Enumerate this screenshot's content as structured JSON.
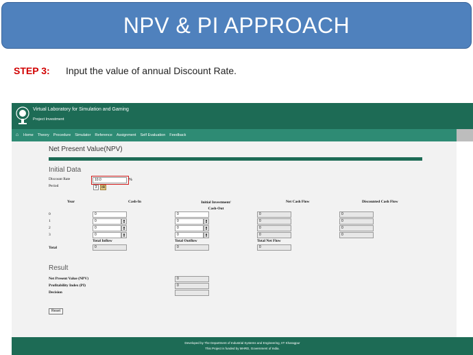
{
  "slide": {
    "title": "NPV & PI APPROACH",
    "step_label": "STEP 3:",
    "step_text": "Input the value of annual Discount Rate."
  },
  "app": {
    "title": "Virtual Laboratory for Simulation and Gaming",
    "subtitle": "Project Investment",
    "nav": [
      "Home",
      "Theory",
      "Procedure",
      "Simulator",
      "Reference",
      "Assignment",
      "Self Evaluation",
      "Feedback"
    ],
    "home_icon": "home-icon",
    "logo_icon": "iit-emblem"
  },
  "page": {
    "title": "Net Present Value(NPV)",
    "initial_heading": "Initial Data",
    "discount_label": "Discount Rate",
    "discount_value": "10.0",
    "discount_unit": "%",
    "period_label": "Period",
    "period_value": "3",
    "period_btn": "ok",
    "columns": [
      "Year",
      "Cash-In",
      "Initial Investment/ Cash-Out",
      "Net Cash Flow",
      "Discounted Cash Flow"
    ],
    "rows": [
      {
        "year": "0",
        "cash_in": "0",
        "cash_out": "0",
        "net": "0",
        "discounted": "0"
      },
      {
        "year": "1",
        "cash_in": "0",
        "cash_out": "0",
        "net": "0",
        "discounted": "0"
      },
      {
        "year": "2",
        "cash_in": "0",
        "cash_out": "0",
        "net": "0",
        "discounted": "0"
      },
      {
        "year": "3",
        "cash_in": "0",
        "cash_out": "0",
        "net": "0",
        "discounted": "0"
      }
    ],
    "total_inflow_label": "Total Inflow",
    "total_outflow_label": "Total Outflow",
    "total_net_label": "Total Net Flow",
    "total_label": "Total",
    "total_inflow": "0",
    "total_outflow": "0",
    "total_net": "0",
    "result_heading": "Result",
    "npv_label": "Net Present Value (NPV)",
    "npv_value": "0",
    "pi_label": "Profitability Index (PI)",
    "pi_value": "0",
    "decision_label": "Decision",
    "decision_value": "",
    "reset_label": "Reset"
  },
  "footer": {
    "line1": "Developed by The Department of Industrial Systems and Engineering, IIT Kharagpur",
    "line2": "This Project is funded by MHRD, Government of India."
  },
  "colors": {
    "banner": "#4f81bd",
    "header": "#1d6b55",
    "nav": "#2e8b74",
    "step_label": "#d10000",
    "highlight": "#d11a1a"
  }
}
